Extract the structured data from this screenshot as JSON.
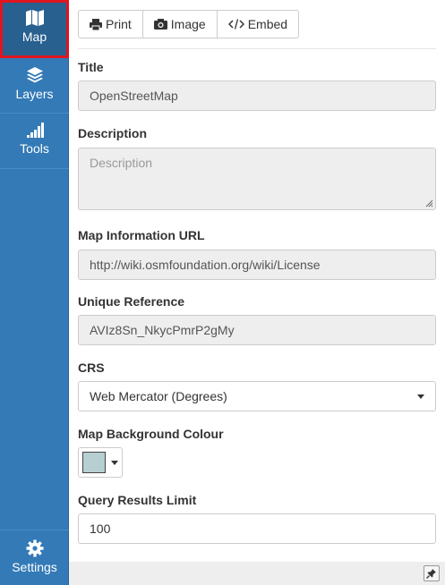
{
  "sidebar": {
    "items": [
      {
        "label": "Map",
        "icon": "map-icon",
        "active": true
      },
      {
        "label": "Layers",
        "icon": "layers-icon"
      },
      {
        "label": "Tools",
        "icon": "signal-bars-icon"
      }
    ],
    "settings": {
      "label": "Settings",
      "icon": "gear-icon"
    }
  },
  "toolbar": {
    "print_label": "Print",
    "image_label": "Image",
    "embed_label": "Embed"
  },
  "form": {
    "title_label": "Title",
    "title_value": "OpenStreetMap",
    "description_label": "Description",
    "description_placeholder": "Description",
    "url_label": "Map Information URL",
    "url_value": "http://wiki.osmfoundation.org/wiki/License",
    "ref_label": "Unique Reference",
    "ref_value": "AVIz8Sn_NkycPmrP2gMy",
    "crs_label": "CRS",
    "crs_value": "Web Mercator (Degrees)",
    "bg_colour_label": "Map Background Colour",
    "bg_colour_value": "#b6cfd0",
    "query_limit_label": "Query Results Limit",
    "query_limit_value": "100"
  },
  "colors": {
    "sidebar": "#337ab7",
    "sidebar_active": "#286090",
    "active_border": "#e0151f"
  }
}
